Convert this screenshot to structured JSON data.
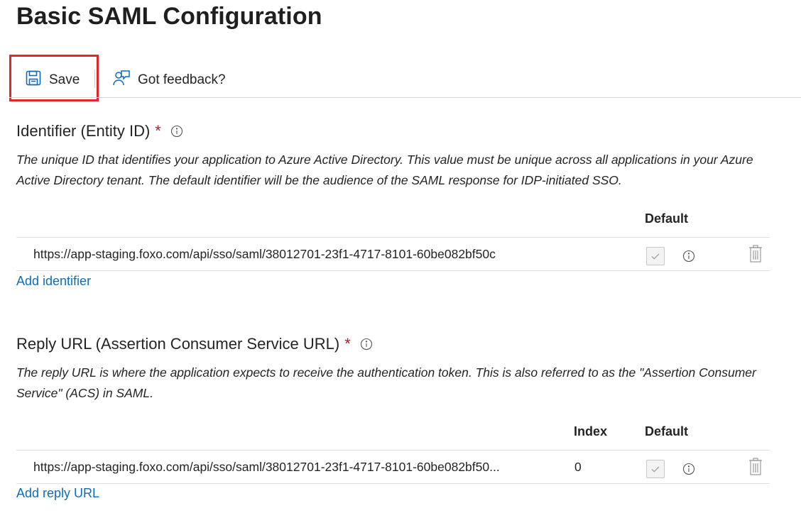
{
  "page": {
    "title": "Basic SAML Configuration"
  },
  "toolbar": {
    "save_label": "Save",
    "feedback_label": "Got feedback?"
  },
  "identifier": {
    "title": "Identifier (Entity ID)",
    "required_mark": "*",
    "description": "The unique ID that identifies your application to Azure Active Directory. This value must be unique across all applications in your Azure Active Directory tenant. The default identifier will be the audience of the SAML response for IDP-initiated SSO.",
    "columns": {
      "default": "Default"
    },
    "rows": [
      {
        "url": "https://app-staging.foxo.com/api/sso/saml/38012701-23f1-4717-8101-60be082bf50c",
        "default_checked": true
      }
    ],
    "add_label": "Add identifier"
  },
  "reply_url": {
    "title": "Reply URL (Assertion Consumer Service URL)",
    "required_mark": "*",
    "description": "The reply URL is where the application expects to receive the authentication token. This is also referred to as the \"Assertion Consumer Service\" (ACS) in SAML.",
    "columns": {
      "index": "Index",
      "default": "Default"
    },
    "rows": [
      {
        "url": "https://app-staging.foxo.com/api/sso/saml/38012701-23f1-4717-8101-60be082bf50...",
        "index": "0",
        "default_checked": true
      }
    ],
    "add_label": "Add reply URL"
  },
  "colors": {
    "accent": "#0f6cbd",
    "required": "#a4262c",
    "highlight": "#e3262a"
  },
  "icons": {
    "save": "save-icon",
    "feedback": "feedback-icon",
    "info": "info-icon",
    "delete": "trash-icon",
    "check": "checkmark-icon"
  }
}
